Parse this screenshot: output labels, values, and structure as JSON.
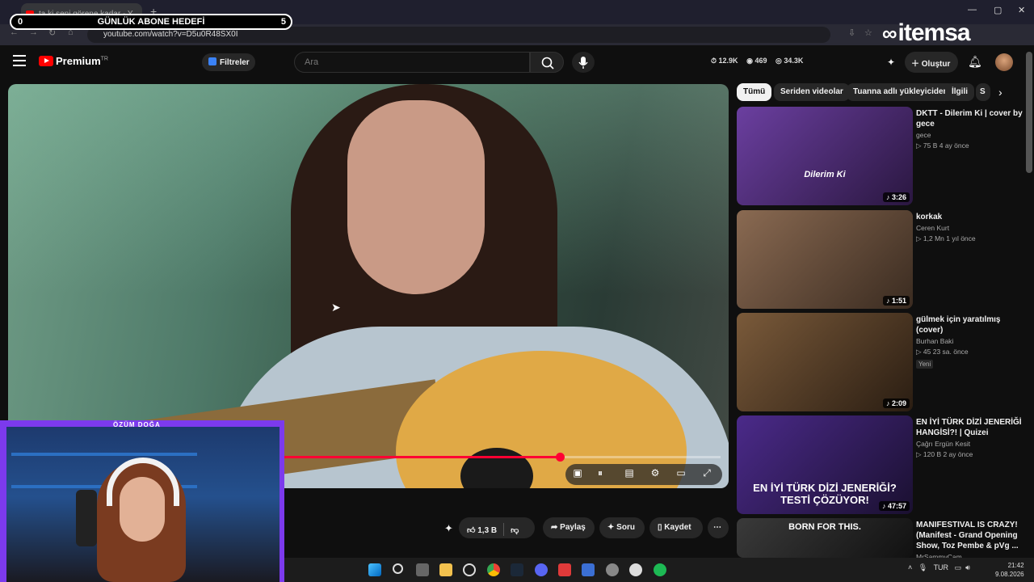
{
  "browser": {
    "tab_title": "ta ki seni görene kadar - Y",
    "new_tab": "+",
    "url": "youtube.com/watch?v=D5u0R48SX0I",
    "window_controls": [
      "—",
      "▢",
      "✕"
    ]
  },
  "goal_overlay": {
    "left_value": "0",
    "title": "GÜNLÜK ABONE HEDEFİ",
    "right_value": "5"
  },
  "brand_watermark": "itemsa",
  "youtube": {
    "logo_text": "Premium",
    "logo_region": "TR",
    "filters_label": "Filtreler",
    "search_placeholder": "Ara",
    "stats": [
      "12.9K",
      "469",
      "34.3K"
    ],
    "create_label": "Oluştur"
  },
  "actions": {
    "likes": "1,3 B",
    "share": "Paylaş",
    "ask": "Soru",
    "save": "Kaydet",
    "more": "⋯"
  },
  "webcam": {
    "name": "ÖZÜM DOĞA"
  },
  "chips": [
    "Tümü",
    "Seriden videolar",
    "Tuanna adlı yükleyiciden",
    "İlgili",
    "S"
  ],
  "recommendations": [
    {
      "title": "DKTT - Dilerim Ki | cover by gece",
      "channel": "gece",
      "views": "75 B",
      "age": "4 ay önce",
      "duration": "3:26",
      "thumb_color_a": "#6b3fa0",
      "thumb_color_b": "#2a1740",
      "thumb_text": "Dilerim Ki"
    },
    {
      "title": "korkak",
      "channel": "Ceren Kurt",
      "views": "1,2 Mn",
      "age": "1 yıl önce",
      "duration": "1:51",
      "thumb_color_a": "#8a6a52",
      "thumb_color_b": "#3a2b20",
      "thumb_text": ""
    },
    {
      "title": "gülmek için yaratılmış (cover)",
      "channel": "Burhan Baki",
      "views": "45",
      "age": "23 sa. önce",
      "duration": "2:09",
      "badge": "Yeni",
      "thumb_color_a": "#7a5a3a",
      "thumb_color_b": "#2a1d12",
      "thumb_text": ""
    },
    {
      "title": "EN İYİ TÜRK DİZİ JENERİĞİ HANGİSİ?! | Quizei",
      "channel": "Çağrı Ergün Kesit",
      "views": "120 B",
      "age": "2 ay önce",
      "duration": "47:57",
      "thumb_color_a": "#4b2a8a",
      "thumb_color_b": "#1a1030",
      "thumb_text": "EN İYİ TÜRK DİZİ JENERİĞİ? TESTİ ÇÖZÜYOR!"
    },
    {
      "title": "MANIFESTIVAL IS CRAZY! (Manifest - Grand Opening Show, Toz Pembe & pVg ...",
      "channel": "MrSammyCam",
      "views": "",
      "age": "",
      "duration": "",
      "thumb_color_a": "#3a3a3a",
      "thumb_color_b": "#111111",
      "thumb_text": "BORN FOR THIS."
    }
  ],
  "taskbar": {
    "language": "TUR",
    "time": "21:42",
    "date": "9.08.2026"
  }
}
